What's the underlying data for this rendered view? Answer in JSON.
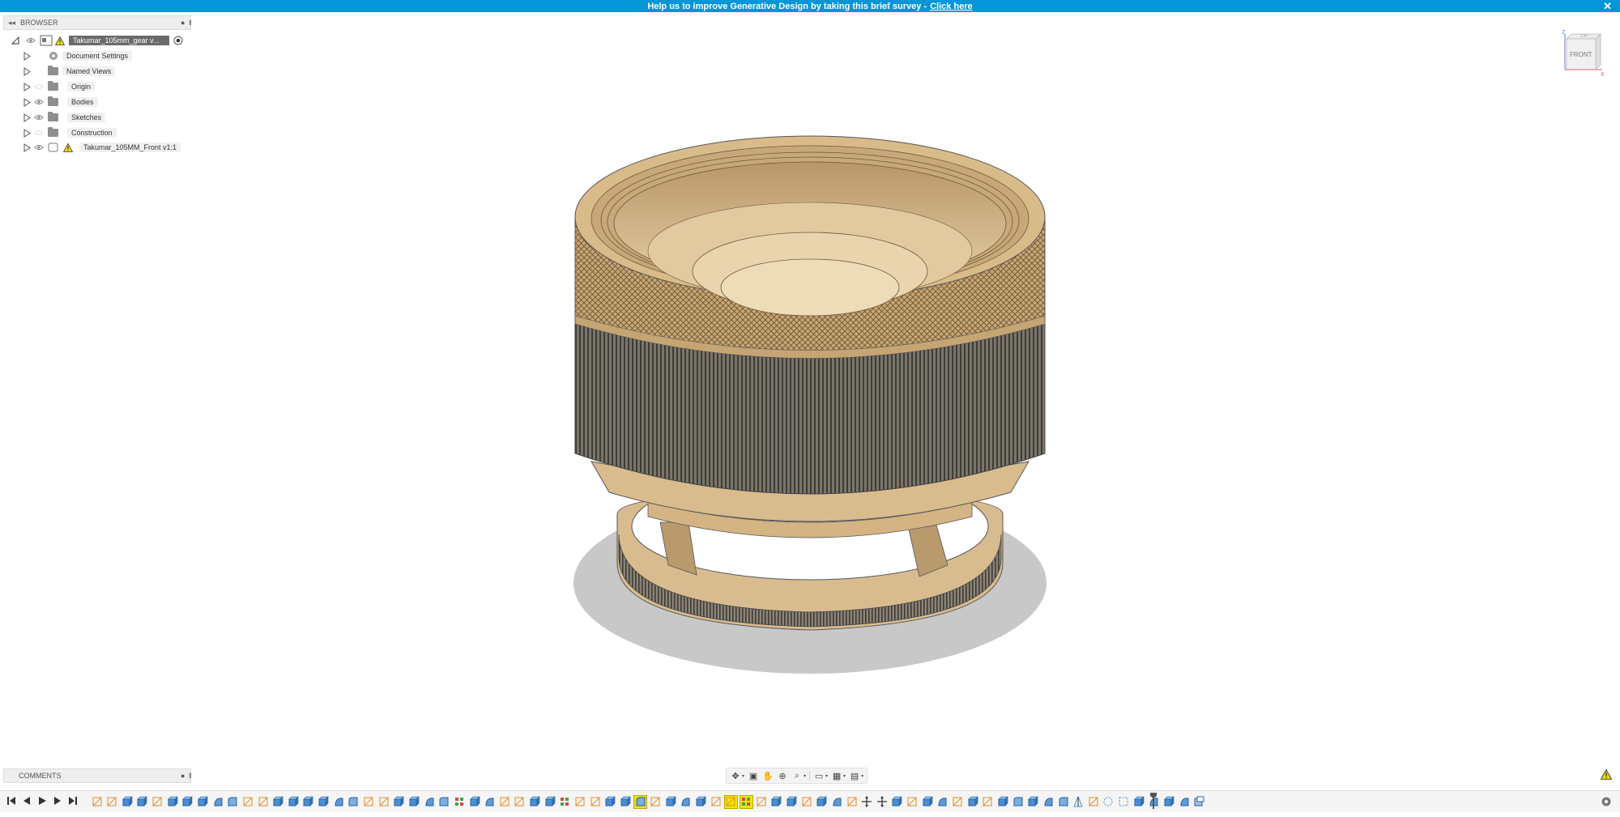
{
  "banner": {
    "text": "Help us to improve Generative Design by taking this brief survey -",
    "link_label": "Click here",
    "close_label": "✕"
  },
  "browser": {
    "title": "BROWSER",
    "root": {
      "label": "Takumar_105mm_gear v..."
    },
    "items": [
      {
        "label": "Document Settings",
        "icon": "gear-icon"
      },
      {
        "label": "Named Views",
        "icon": "folder-icon"
      },
      {
        "label": "Origin",
        "icon": "folder-icon"
      },
      {
        "label": "Bodies",
        "icon": "folder-icon"
      },
      {
        "label": "Sketches",
        "icon": "folder-icon"
      },
      {
        "label": "Construction",
        "icon": "folder-icon"
      },
      {
        "label": "Takumar_105MM_Front v1:1",
        "icon": "component-icon"
      }
    ]
  },
  "viewcube": {
    "top_label": "TOP",
    "front_label": "FRONT",
    "z_label": "Z",
    "x_label": "X"
  },
  "comments": {
    "title": "COMMENTS"
  },
  "colors": {
    "banner": "#0696d7",
    "model_top": "#d4b483",
    "model_dark": "#6f6a60",
    "timeline_active": "#f3e600"
  },
  "timeline": {
    "features": [
      "sketch",
      "sketch",
      "extrude",
      "extrude",
      "sketch",
      "extrude",
      "extrude",
      "extrude",
      "revolve",
      "fillet",
      "sketch",
      "sketch",
      "extrude",
      "extrude",
      "extrude",
      "extrude",
      "revolve",
      "fillet",
      "sketch",
      "sketch",
      "extrude",
      "extrude",
      "revolve",
      "fillet",
      "pattern",
      "extrude",
      "revolve",
      "sketch",
      "sketch",
      "extrude",
      "extrude",
      "pattern",
      "sketch",
      "sketch",
      "extrude",
      "extrude",
      "fillet-active",
      "sketch",
      "extrude",
      "revolve",
      "extrude",
      "sketch",
      "active-sketch",
      "active-pattern",
      "sketch",
      "extrude",
      "extrude",
      "sketch",
      "extrude",
      "revolve",
      "sketch",
      "move",
      "move",
      "extrude",
      "sketch",
      "extrude",
      "revolve",
      "sketch",
      "extrude",
      "sketch",
      "extrude",
      "fillet",
      "extrude",
      "revolve",
      "fillet",
      "mirror",
      "sketch",
      "joint",
      "dashed",
      "extrude",
      "revolve",
      "extrude",
      "revolve",
      "cut"
    ]
  }
}
